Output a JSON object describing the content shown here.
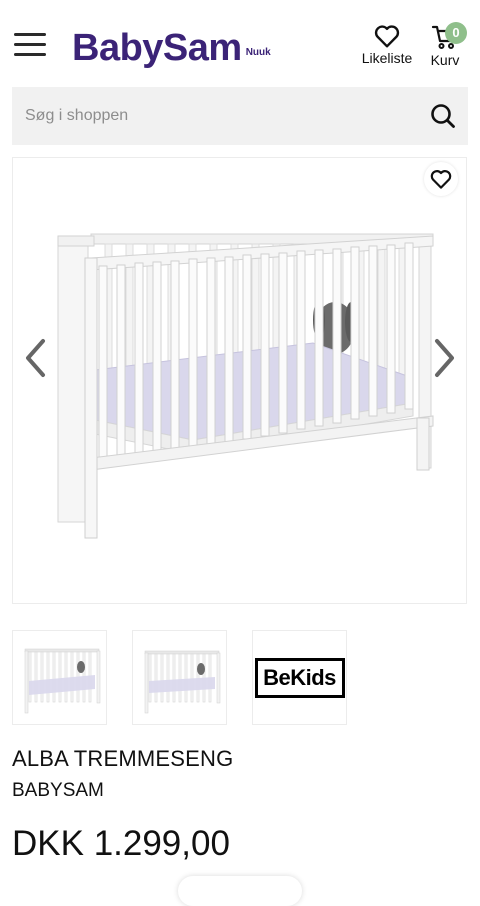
{
  "header": {
    "logo_text": "BabySam",
    "logo_location": "Nuuk",
    "likes_label": "Likeliste",
    "cart_label": "Kurv",
    "cart_count": "0"
  },
  "search": {
    "placeholder": "Søg i shoppen",
    "value": ""
  },
  "gallery": {
    "thumbnails": [
      "crib-photo",
      "crib-photo",
      "BeKids"
    ]
  },
  "product": {
    "title": "ALBA TREMMESENG",
    "brand": "BABYSAM",
    "price": "DKK 1.299,00"
  },
  "colors": {
    "brand": "#3b2377",
    "badge": "#8fbf8b",
    "search_bg": "#f1f1f1"
  }
}
